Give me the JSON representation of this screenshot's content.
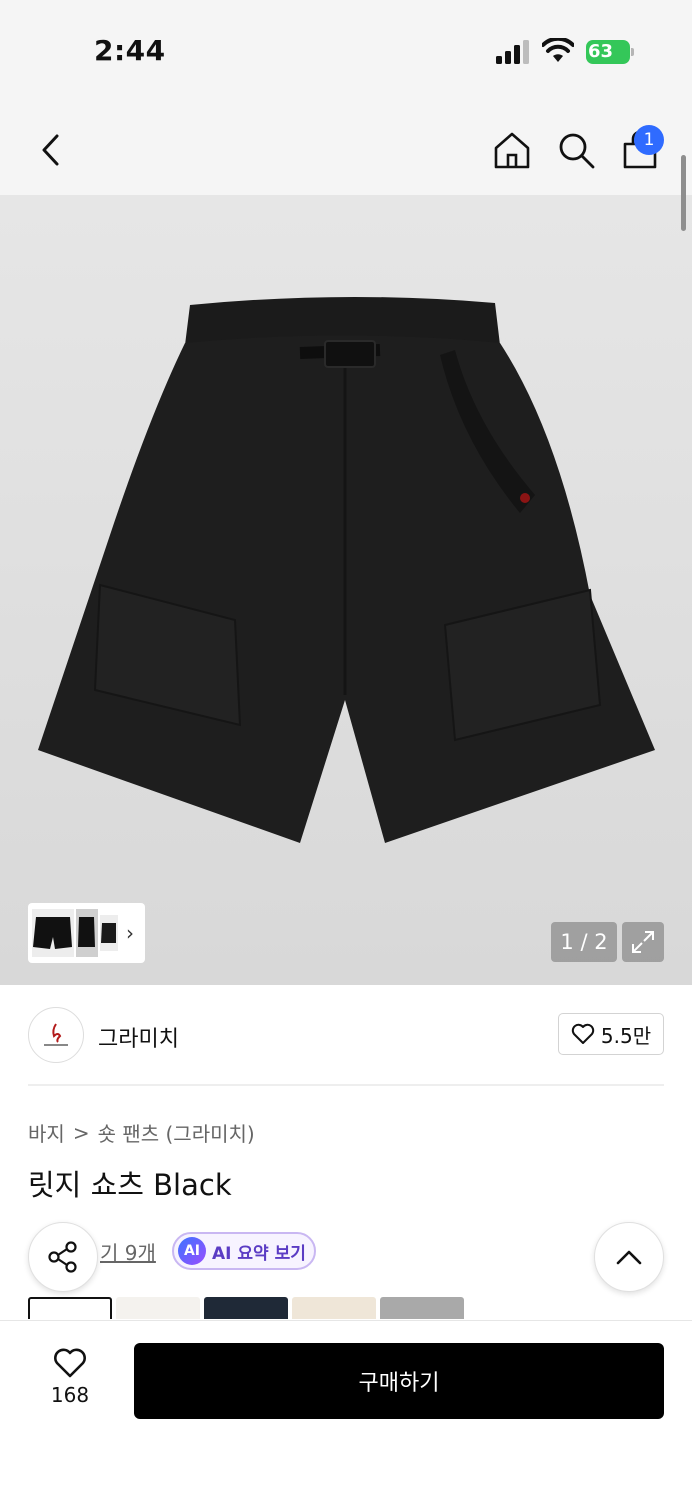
{
  "status_bar": {
    "time": "2:44",
    "battery": "63"
  },
  "nav": {
    "cart_count": "1"
  },
  "gallery": {
    "counter": "1 / 2"
  },
  "brand": {
    "name": "그라미치",
    "likes": "5.5만"
  },
  "breadcrumb": {
    "category": "바지",
    "separator": ">",
    "subcategory": "숏 팬츠 (그라미치)"
  },
  "product": {
    "title": "릿지 쇼츠 Black"
  },
  "reviews": {
    "link_text": "기 9개"
  },
  "ai_summary": {
    "badge": "AI",
    "label": "AI 요약 보기"
  },
  "bottom_bar": {
    "like_count": "168",
    "buy_label": "구매하기"
  },
  "colors": {
    "accent_blue": "#2f6bff",
    "battery_green": "#34c759",
    "buy_button": "#000000"
  },
  "icons": [
    "back-icon",
    "home-icon",
    "search-icon",
    "shopping-bag-icon",
    "expand-icon",
    "heart-icon",
    "share-icon",
    "chevron-up-icon",
    "chevron-right-icon"
  ]
}
